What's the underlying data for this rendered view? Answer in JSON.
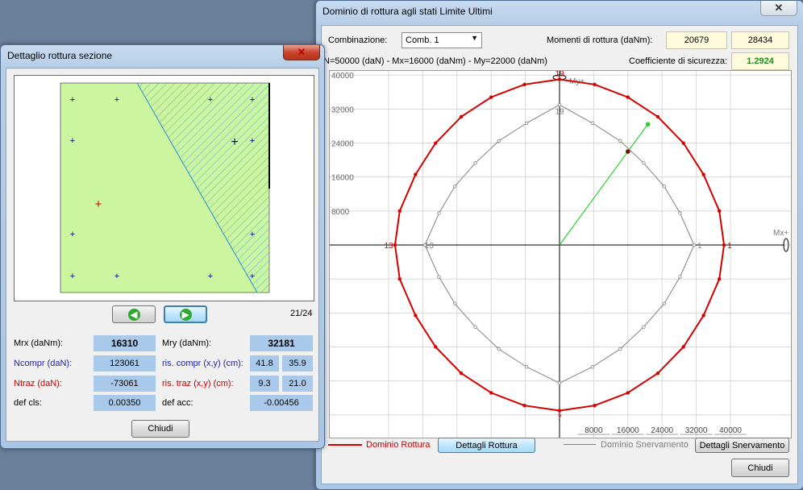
{
  "left_window": {
    "title": "Dettaglio rottura sezione",
    "page_indicator": "21/24",
    "fields": {
      "mrx": {
        "label": "Mrx (daNm):",
        "value": "16310"
      },
      "mry": {
        "label": "Mry (daNm):",
        "value": "32181"
      },
      "ncompr": {
        "label": "Ncompr (daN):",
        "value": "123061"
      },
      "ris_compr": {
        "label": "ris. compr (x,y) (cm):",
        "x": "41.8",
        "y": "35.9"
      },
      "ntraz": {
        "label": "Ntraz (daN):",
        "value": "-73061"
      },
      "ris_traz": {
        "label": "ris. traz (x,y) (cm):",
        "x": "9.3",
        "y": "21.0"
      },
      "def_cls": {
        "label": "def cls:",
        "value": "0.00350"
      },
      "def_acc": {
        "label": "def acc:",
        "value": "-0.00456"
      }
    },
    "close_label": "Chiudi",
    "icons": {
      "prev": "arrow-left-icon",
      "next": "arrow-right-icon"
    },
    "colors": {
      "section_fill": "#ccf5a0",
      "bar": "#00007f",
      "centroid": "#d00000",
      "neutral_axis": "#2a8fd0"
    }
  },
  "right_window": {
    "title": "Dominio di rottura agli stati Limite Ultimi",
    "combinazione_label": "Combinazione:",
    "combinazione_value": "Comb. 1",
    "momenti_label": "Momenti di rottura (daNm):",
    "momenti_values": [
      "20679",
      "28434"
    ],
    "load_info": "N=50000 (daN) - Mx=16000 (daNm) - My=22000 (daNm)",
    "coeff_label": "Coefficiente di sicurezza:",
    "coeff_value": "1.2924",
    "legend_rottura": "Dominio Rottura",
    "btn_dettagli_rottura": "Dettagli Rottura",
    "legend_snervamento": "Dominio Snervamento",
    "btn_dettagli_snervamento": "Dettagli Snervamento",
    "close_label": "Chiudi",
    "colors": {
      "rottura": "#d40000",
      "snervamento": "#808080",
      "load_path": "#33cc33",
      "accent_value": "#1a8f1a"
    }
  },
  "chart_data": {
    "type": "line",
    "xlabel": "Mx+",
    "ylabel": "My+",
    "xlim": [
      -42000,
      42000
    ],
    "ylim": [
      -44000,
      44000
    ],
    "y_ticks": [
      "40000",
      "32000",
      "24000",
      "16000",
      "8000"
    ],
    "x_ticks": [
      "8000",
      "16000",
      "24000",
      "32000",
      "40000"
    ],
    "grid": true,
    "series": [
      {
        "name": "Dominio Rottura",
        "points": [
          [
            0,
            39000
          ],
          [
            -8200,
            37800
          ],
          [
            -16000,
            34800
          ],
          [
            -23000,
            30200
          ],
          [
            -29000,
            24000
          ],
          [
            -33700,
            16600
          ],
          [
            -37400,
            8000
          ],
          [
            -38500,
            0
          ],
          [
            -37400,
            -8000
          ],
          [
            -33700,
            -16600
          ],
          [
            -29000,
            -24000
          ],
          [
            -23000,
            -30200
          ],
          [
            -16000,
            -34800
          ],
          [
            -8200,
            -37800
          ],
          [
            0,
            -39000
          ],
          [
            8200,
            -37800
          ],
          [
            16000,
            -34800
          ],
          [
            23000,
            -30200
          ],
          [
            29000,
            -24000
          ],
          [
            33700,
            -16600
          ],
          [
            37400,
            -8000
          ],
          [
            38500,
            0
          ],
          [
            37400,
            8000
          ],
          [
            33700,
            16600
          ],
          [
            29000,
            24000
          ],
          [
            23000,
            30200
          ],
          [
            16000,
            34800
          ],
          [
            8200,
            37800
          ]
        ],
        "labels": [
          {
            "text": "13",
            "x": -40000,
            "y": 0
          },
          {
            "text": "1",
            "x": 39800,
            "y": 0
          },
          {
            "text": "19",
            "x": 0,
            "y": 40500
          },
          {
            "text": "7",
            "x": 0,
            "y": -40500
          }
        ]
      },
      {
        "name": "Dominio Snervamento",
        "points": [
          [
            0,
            33000
          ],
          [
            -7700,
            28700
          ],
          [
            -14200,
            24500
          ],
          [
            -19700,
            19300
          ],
          [
            -24500,
            13800
          ],
          [
            -28200,
            7500
          ],
          [
            -31500,
            0
          ],
          [
            -28200,
            -7500
          ],
          [
            -24500,
            -13800
          ],
          [
            -19700,
            -19300
          ],
          [
            -14200,
            -24500
          ],
          [
            -7700,
            -28700
          ],
          [
            0,
            -32500
          ],
          [
            7700,
            -28700
          ],
          [
            14200,
            -24500
          ],
          [
            19700,
            -19300
          ],
          [
            24500,
            -13800
          ],
          [
            28200,
            -7500
          ],
          [
            31500,
            0
          ],
          [
            28200,
            7500
          ],
          [
            24500,
            13800
          ],
          [
            19700,
            19300
          ],
          [
            14200,
            24500
          ],
          [
            7700,
            28700
          ]
        ],
        "labels": [
          {
            "text": "13",
            "x": -30500,
            "y": 0
          },
          {
            "text": "1",
            "x": 32800,
            "y": 0
          },
          {
            "text": "19",
            "x": 0,
            "y": 31600
          }
        ]
      },
      {
        "name": "load-path",
        "points": [
          [
            0,
            0
          ],
          [
            20679,
            28434
          ]
        ],
        "markers": [
          [
            16000,
            22000
          ],
          [
            20679,
            28434
          ]
        ]
      }
    ]
  }
}
